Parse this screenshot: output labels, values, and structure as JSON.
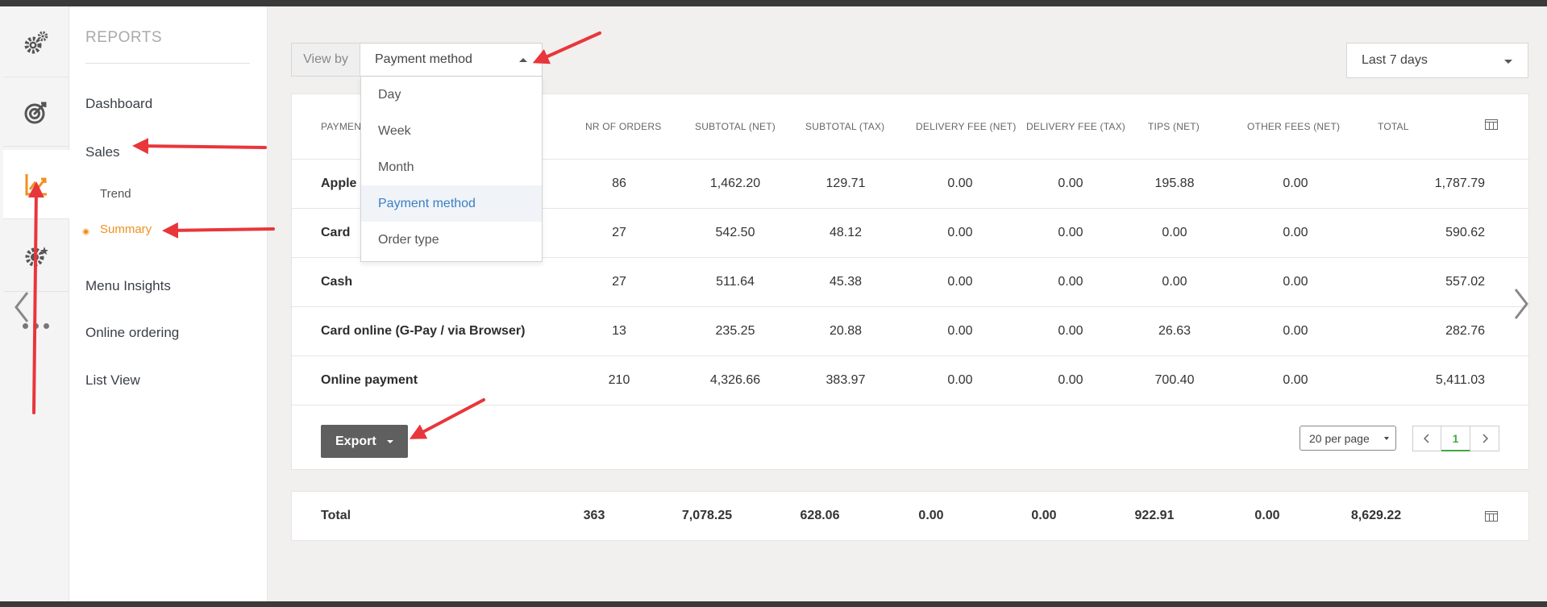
{
  "sidebar_rail": {
    "items": [
      {
        "icon": "gears-icon"
      },
      {
        "icon": "target-icon"
      },
      {
        "icon": "chart-line-icon",
        "active": true
      },
      {
        "icon": "gear-star-icon"
      },
      {
        "icon": "more-dots-icon"
      }
    ]
  },
  "reports_menu": {
    "title": "REPORTS",
    "items": {
      "dashboard": "Dashboard",
      "sales": "Sales",
      "trend": "Trend",
      "summary": "Summary",
      "menu_insights": "Menu Insights",
      "online_ordering": "Online ordering",
      "list_view": "List View"
    }
  },
  "filters": {
    "view_by_label": "View by",
    "view_by_value": "Payment method",
    "options": [
      "Day",
      "Week",
      "Month",
      "Payment method",
      "Order type"
    ],
    "range_value": "Last 7 days"
  },
  "table": {
    "headers": [
      "PAYMENT METHOD",
      "NR OF ORDERS",
      "SUBTOTAL (NET)",
      "SUBTOTAL (TAX)",
      "DELIVERY FEE (NET)",
      "DELIVERY FEE (TAX)",
      "TIPS (NET)",
      "OTHER FEES (NET)",
      "TOTAL"
    ],
    "header_first_visible": "PAYMEN",
    "rows": [
      {
        "name": "Apple",
        "values": [
          "86",
          "1,462.20",
          "129.71",
          "0.00",
          "0.00",
          "195.88",
          "0.00",
          "1,787.79"
        ]
      },
      {
        "name": "Card",
        "values": [
          "27",
          "542.50",
          "48.12",
          "0.00",
          "0.00",
          "0.00",
          "0.00",
          "590.62"
        ]
      },
      {
        "name": "Cash",
        "values": [
          "27",
          "511.64",
          "45.38",
          "0.00",
          "0.00",
          "0.00",
          "0.00",
          "557.02"
        ]
      },
      {
        "name": "Card online (G-Pay / via Browser)",
        "values": [
          "13",
          "235.25",
          "20.88",
          "0.00",
          "0.00",
          "26.63",
          "0.00",
          "282.76"
        ]
      },
      {
        "name": "Online payment",
        "values": [
          "210",
          "4,326.66",
          "383.97",
          "0.00",
          "0.00",
          "700.40",
          "0.00",
          "5,411.03"
        ]
      }
    ]
  },
  "footer": {
    "export_label": "Export",
    "per_page": "20 per page",
    "current_page": "1"
  },
  "totals": {
    "label": "Total",
    "values": [
      "363",
      "7,078.25",
      "628.06",
      "0.00",
      "0.00",
      "922.91",
      "0.00",
      "8,629.22"
    ]
  },
  "colors": {
    "accent_orange": "#f0901e",
    "selected_blue": "#3b7ec4",
    "annotation_red": "#e8363b",
    "pager_green": "#42a942"
  }
}
